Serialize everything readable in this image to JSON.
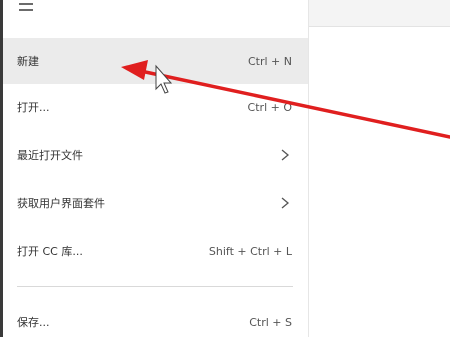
{
  "menu": {
    "items": [
      {
        "label": "新建",
        "shortcut": "Ctrl + N"
      },
      {
        "label": "打开...",
        "shortcut": "Ctrl + O"
      },
      {
        "label": "最近打开文件",
        "icon": "chevron-right-icon"
      },
      {
        "label": "获取用户界面套件",
        "icon": "chevron-right-icon"
      },
      {
        "label": "打开 CC 库...",
        "shortcut": "Shift + Ctrl + L"
      },
      {
        "label": "保存...",
        "shortcut": "Ctrl + S"
      }
    ]
  },
  "annotation": {
    "arrow_color": "#e01f1f"
  },
  "colors": {
    "hover_background": "#ebebeb",
    "divider": "#d9d9d9"
  }
}
